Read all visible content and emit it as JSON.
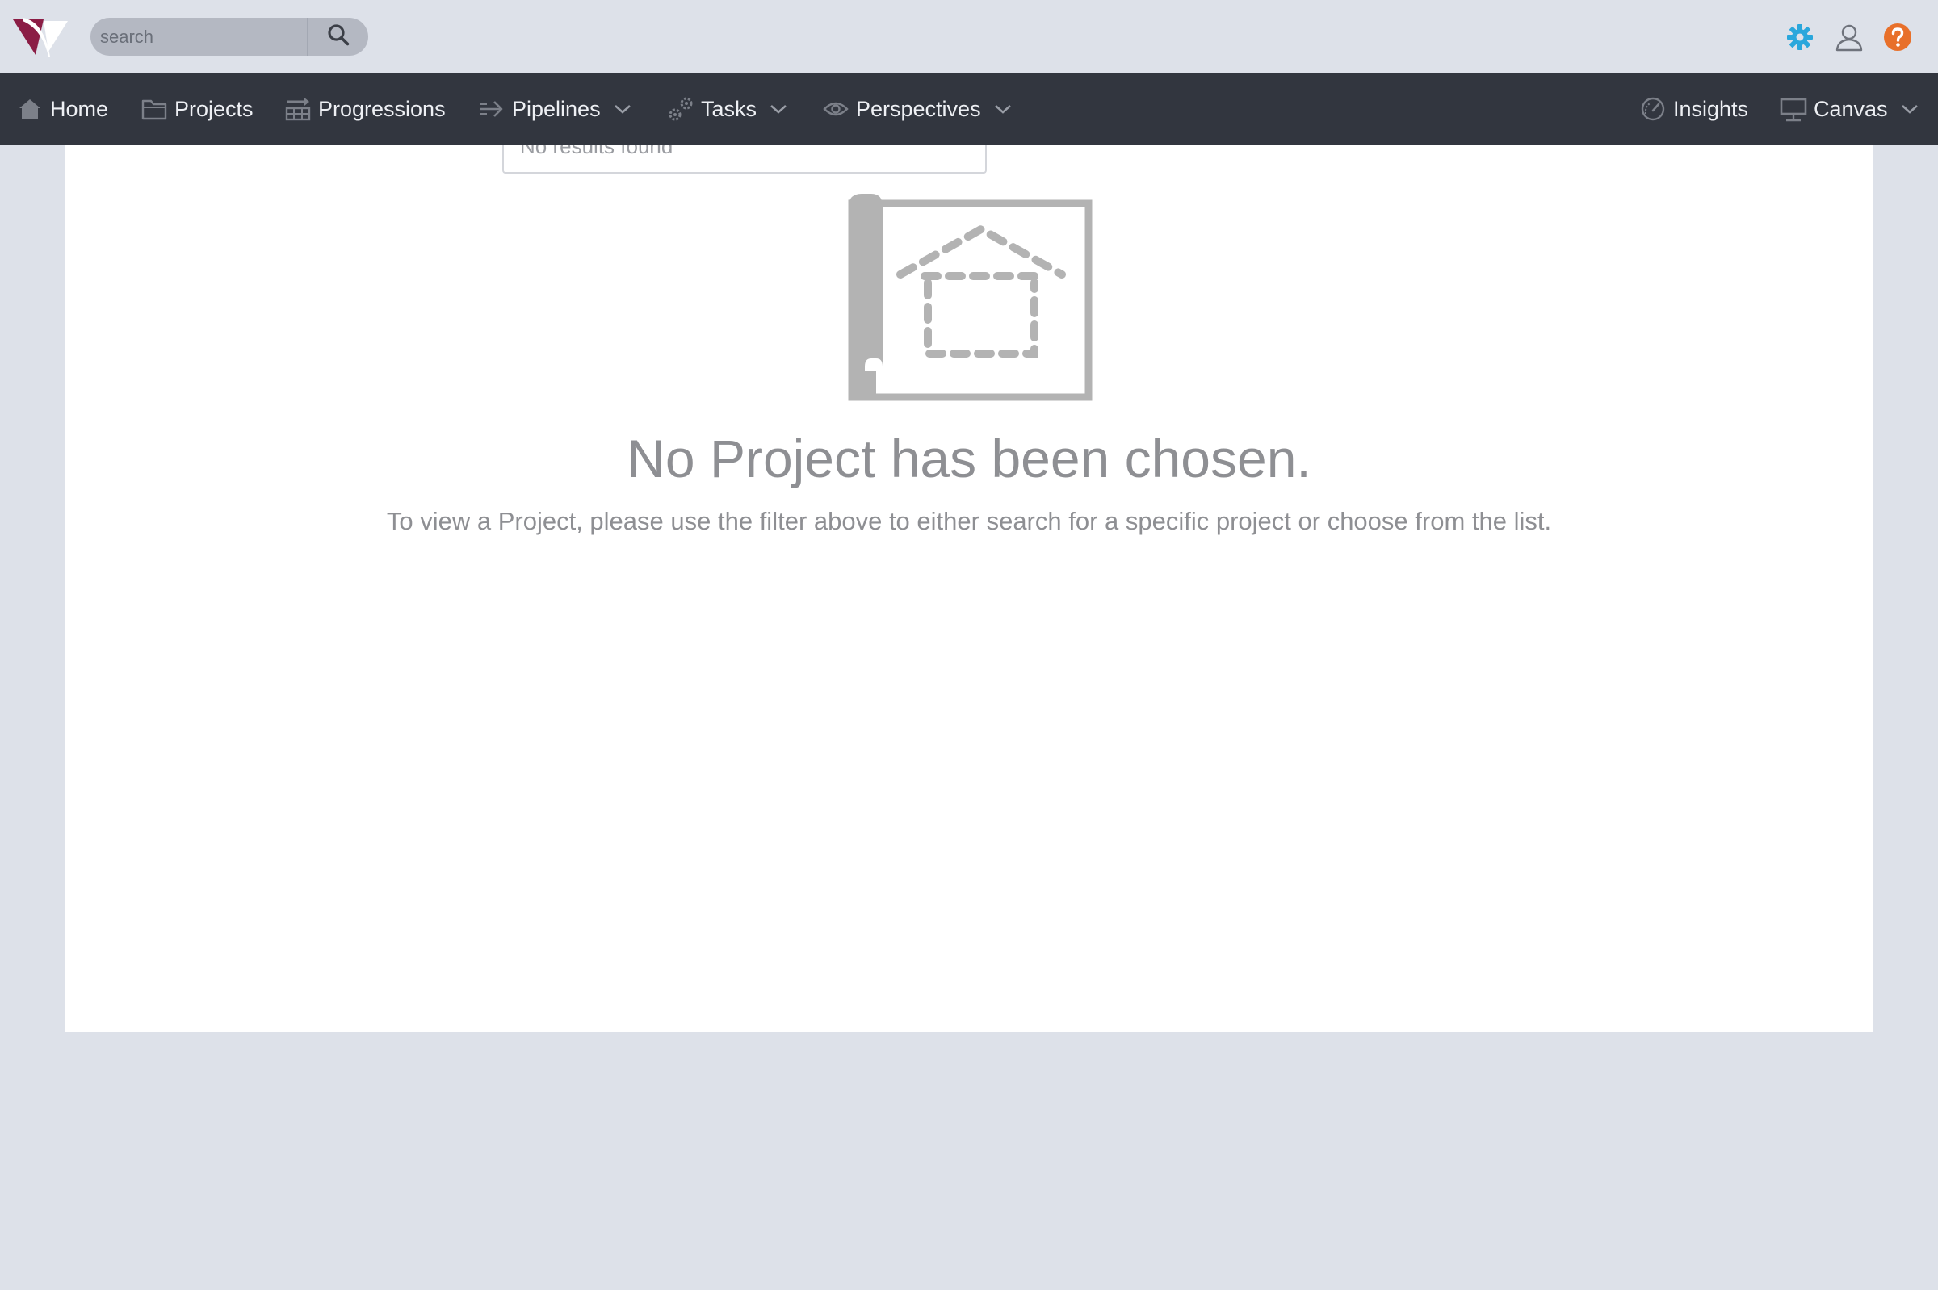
{
  "search": {
    "placeholder": "search"
  },
  "nav": {
    "items": [
      {
        "label": "Home",
        "icon": "home-icon"
      },
      {
        "label": "Projects",
        "icon": "folder-icon"
      },
      {
        "label": "Progressions",
        "icon": "progressions-icon"
      },
      {
        "label": "Pipelines",
        "icon": "arrow-right-icon",
        "dropdown": true
      },
      {
        "label": "Tasks",
        "icon": "gears-icon",
        "dropdown": true
      },
      {
        "label": "Perspectives",
        "icon": "eye-icon",
        "dropdown": true
      },
      {
        "label": "Insights",
        "icon": "gauge-icon"
      },
      {
        "label": "Canvas",
        "icon": "easel-icon",
        "dropdown": true
      }
    ]
  },
  "top_icons": [
    "gear-icon",
    "user-icon",
    "help-icon"
  ],
  "colors": {
    "brand": "#8b1d45",
    "gear": "#2aa7dc",
    "help": "#e8702a",
    "navbar": "#32363f",
    "background": "#dde1e9"
  },
  "dropdown": {
    "message": "No results found"
  },
  "empty_state": {
    "title": "No Project has been chosen.",
    "description": "To view a Project, please use the filter above to either search for a specific project or choose from the list."
  }
}
